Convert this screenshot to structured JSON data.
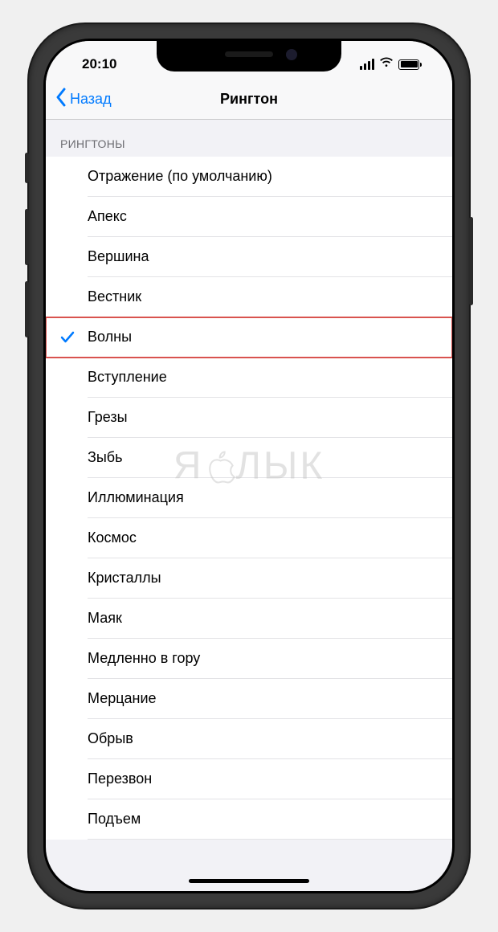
{
  "status": {
    "time": "20:10"
  },
  "nav": {
    "back_label": "Назад",
    "title": "Рингтон"
  },
  "section": {
    "header": "РИНГТОНЫ"
  },
  "ringtones": [
    {
      "label": "Отражение (по умолчанию)",
      "selected": false,
      "highlighted": false
    },
    {
      "label": "Апекс",
      "selected": false,
      "highlighted": false
    },
    {
      "label": "Вершина",
      "selected": false,
      "highlighted": false
    },
    {
      "label": "Вестник",
      "selected": false,
      "highlighted": false
    },
    {
      "label": "Волны",
      "selected": true,
      "highlighted": true
    },
    {
      "label": "Вступление",
      "selected": false,
      "highlighted": false
    },
    {
      "label": "Грезы",
      "selected": false,
      "highlighted": false
    },
    {
      "label": "Зыбь",
      "selected": false,
      "highlighted": false
    },
    {
      "label": "Иллюминация",
      "selected": false,
      "highlighted": false
    },
    {
      "label": "Космос",
      "selected": false,
      "highlighted": false
    },
    {
      "label": "Кристаллы",
      "selected": false,
      "highlighted": false
    },
    {
      "label": "Маяк",
      "selected": false,
      "highlighted": false
    },
    {
      "label": "Медленно в гору",
      "selected": false,
      "highlighted": false
    },
    {
      "label": "Мерцание",
      "selected": false,
      "highlighted": false
    },
    {
      "label": "Обрыв",
      "selected": false,
      "highlighted": false
    },
    {
      "label": "Перезвон",
      "selected": false,
      "highlighted": false
    },
    {
      "label": "Подъем",
      "selected": false,
      "highlighted": false
    }
  ],
  "watermark": {
    "text_left": "Я",
    "text_right": "ЛЫК"
  }
}
